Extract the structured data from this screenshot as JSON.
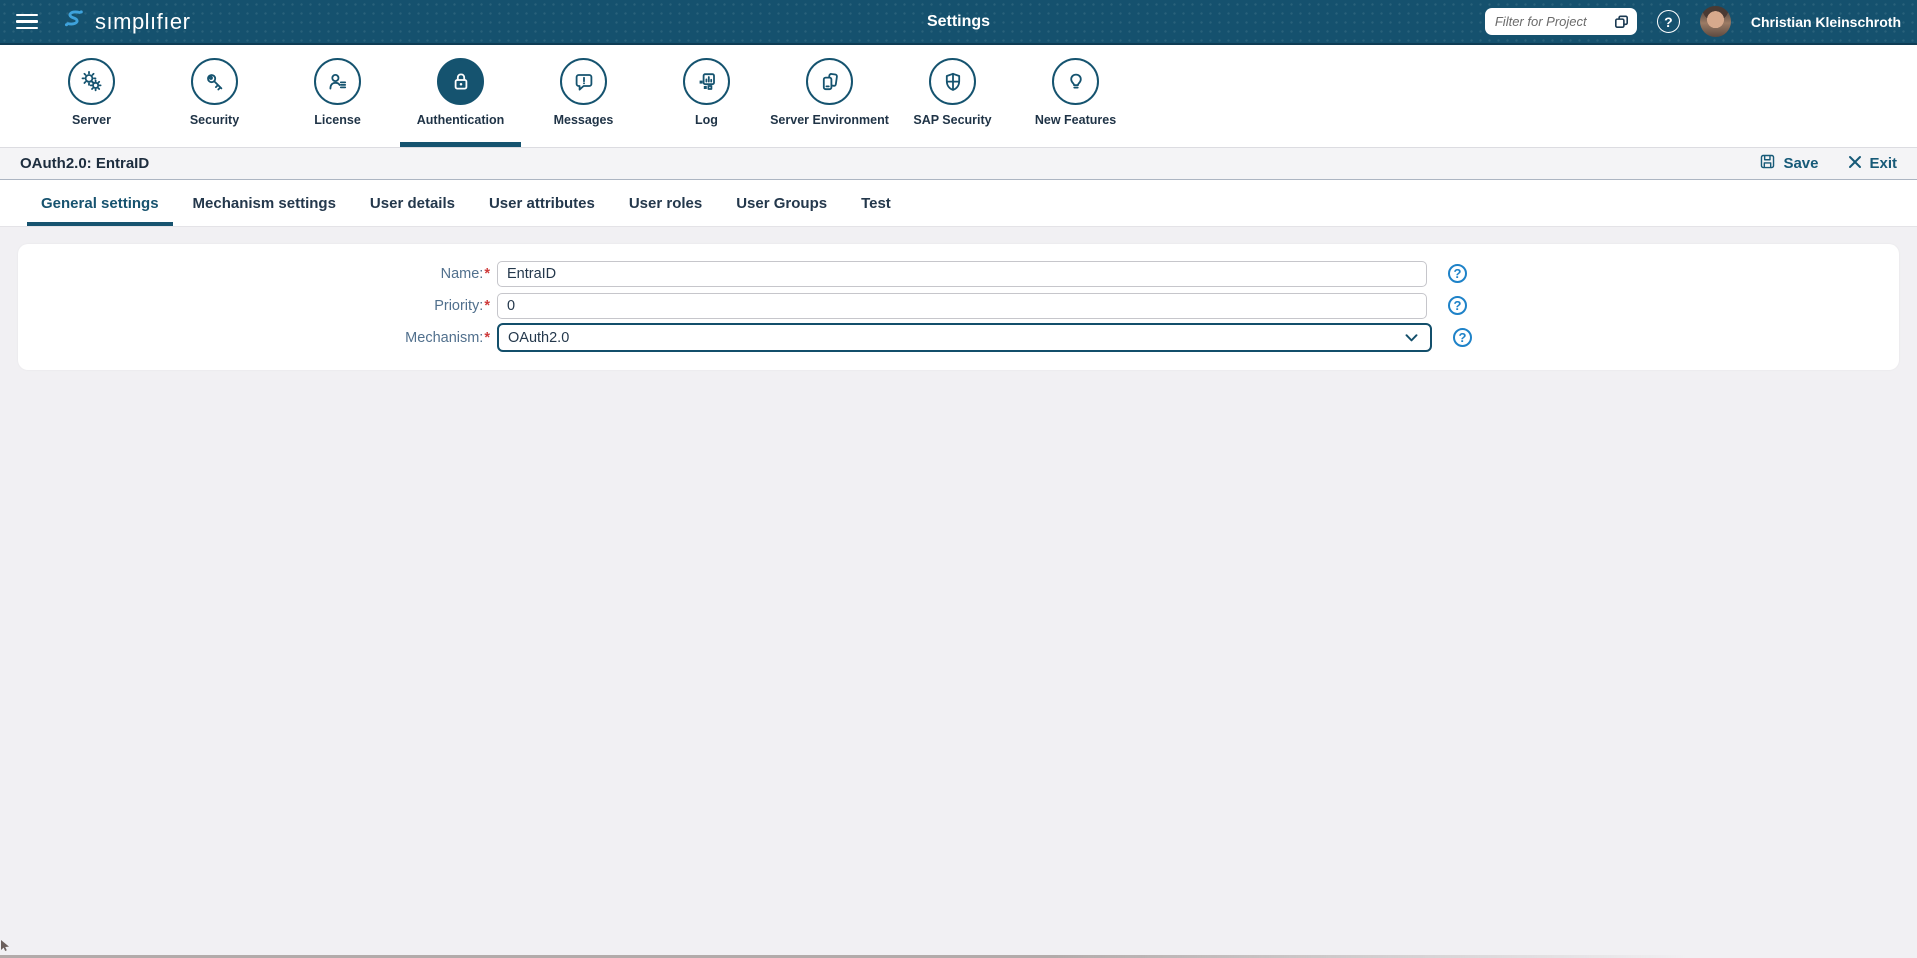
{
  "header": {
    "app_name": "sımplıfıer",
    "page_title": "Settings",
    "filter_placeholder": "Filter for Project",
    "user_name": "Christian Kleinschroth"
  },
  "icon_tabs": {
    "items": [
      {
        "label": "Server",
        "icon": "server-gears-icon",
        "active": false
      },
      {
        "label": "Security",
        "icon": "security-key-icon",
        "active": false
      },
      {
        "label": "License",
        "icon": "license-person-icon",
        "active": false
      },
      {
        "label": "Authentication",
        "icon": "authentication-lock-icon",
        "active": true
      },
      {
        "label": "Messages",
        "icon": "messages-bubble-icon",
        "active": false
      },
      {
        "label": "Log",
        "icon": "log-chart-icon",
        "active": false
      },
      {
        "label": "Server Environment",
        "icon": "server-environment-icon",
        "active": false
      },
      {
        "label": "SAP Security",
        "icon": "sap-security-shield-icon",
        "active": false
      },
      {
        "label": "New Features",
        "icon": "new-features-bulb-icon",
        "active": false
      }
    ]
  },
  "toolbar": {
    "title": "OAuth2.0: EntraID",
    "save_label": "Save",
    "exit_label": "Exit"
  },
  "sub_tabs": {
    "active_index": 0,
    "items": [
      "General settings",
      "Mechanism settings",
      "User details",
      "User attributes",
      "User roles",
      "User Groups",
      "Test"
    ]
  },
  "form": {
    "fields": [
      {
        "label": "Name:",
        "required": true,
        "type": "text",
        "value": "EntraID"
      },
      {
        "label": "Priority:",
        "required": true,
        "type": "text",
        "value": "0"
      },
      {
        "label": "Mechanism:",
        "required": true,
        "type": "select",
        "value": "OAuth2.0"
      }
    ]
  },
  "colors": {
    "header_bg": "#15516E",
    "accent_teal": "#15536F",
    "action_teal": "#175A78",
    "help_blue": "#1E82C8",
    "required_red": "#CE3B3B",
    "logo_blue": "#3EA2DC",
    "page_bg": "#F1F0F3"
  }
}
